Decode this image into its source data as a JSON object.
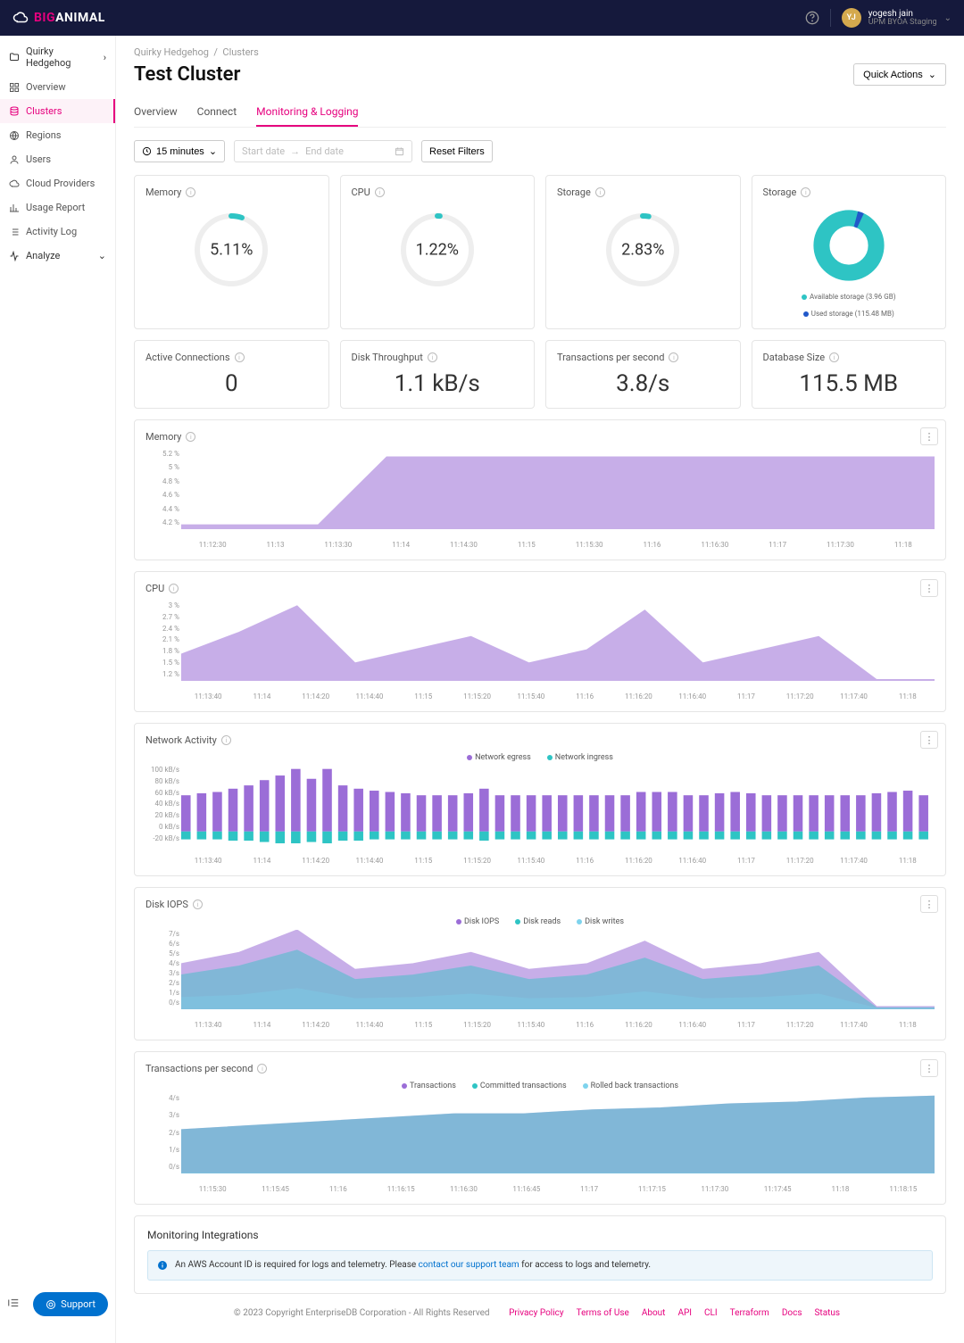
{
  "brand": {
    "big": "BIG",
    "animal": "ANIMAL"
  },
  "user": {
    "initials": "YJ",
    "name": "yogesh jain",
    "org": "UPM BYOA Staging"
  },
  "sidebar": {
    "project": "Quirky Hedgehog",
    "items": [
      {
        "label": "Overview"
      },
      {
        "label": "Clusters"
      },
      {
        "label": "Regions"
      },
      {
        "label": "Users"
      },
      {
        "label": "Cloud Providers"
      },
      {
        "label": "Usage Report"
      },
      {
        "label": "Activity Log"
      },
      {
        "label": "Analyze"
      }
    ],
    "support": "Support"
  },
  "breadcrumb": {
    "project": "Quirky Hedgehog",
    "section": "Clusters"
  },
  "page": {
    "title": "Test Cluster",
    "quick_actions": "Quick Actions"
  },
  "tabs": [
    "Overview",
    "Connect",
    "Monitoring & Logging"
  ],
  "filters": {
    "timerange": "15 minutes",
    "start": "Start date",
    "end": "End date",
    "reset": "Reset Filters"
  },
  "gauges": [
    {
      "title": "Memory",
      "value": "5.11%",
      "pct": 5.11
    },
    {
      "title": "CPU",
      "value": "1.22%",
      "pct": 1.22
    },
    {
      "title": "Storage",
      "value": "2.83%",
      "pct": 2.83
    }
  ],
  "storage_donut": {
    "title": "Storage",
    "available": "Available storage (3.96 GB)",
    "used": "Used storage (115.48 MB)"
  },
  "metrics": [
    {
      "title": "Active Connections",
      "value": "0"
    },
    {
      "title": "Disk Throughput",
      "value": "1.1 kB/s"
    },
    {
      "title": "Transactions per second",
      "value": "3.8/s"
    },
    {
      "title": "Database Size",
      "value": "115.5 MB"
    }
  ],
  "integrations": {
    "title": "Monitoring Integrations",
    "banner_pre": "An AWS Account ID is required for logs and telemetry. Please ",
    "banner_link": "contact our support team",
    "banner_post": " for access to logs and telemetry."
  },
  "footer": {
    "copy": "© 2023 Copyright EnterpriseDB Corporation - All Rights Reserved",
    "links": [
      "Privacy Policy",
      "Terms of Use",
      "About",
      "API",
      "CLI",
      "Terraform",
      "Docs",
      "Status"
    ]
  },
  "chart_data": [
    {
      "type": "area",
      "title": "Memory",
      "color": "#9b6dd7",
      "y_ticks": [
        "5.2 %",
        "5 %",
        "4.8 %",
        "4.6 %",
        "4.4 %",
        "4.2 %"
      ],
      "x_ticks": [
        "11:12:30",
        "11:13",
        "11:13:30",
        "11:14",
        "11:14:30",
        "11:15",
        "11:15:30",
        "11:16",
        "11:16:30",
        "11:17",
        "11:17:30",
        "11:18"
      ],
      "series": [
        {
          "name": "Memory",
          "values": [
            4.25,
            4.25,
            4.25,
            5.11,
            5.11,
            5.11,
            5.11,
            5.11,
            5.11,
            5.11,
            5.11,
            5.11
          ]
        }
      ],
      "ylim": [
        4.2,
        5.2
      ]
    },
    {
      "type": "area",
      "title": "CPU",
      "color": "#9b6dd7",
      "y_ticks": [
        "3 %",
        "2.7 %",
        "2.4 %",
        "2.1 %",
        "1.8 %",
        "1.5 %",
        "1.2 %"
      ],
      "x_ticks": [
        "11:13:40",
        "11:14",
        "11:14:20",
        "11:14:40",
        "11:15",
        "11:15:20",
        "11:15:40",
        "11:16",
        "11:16:20",
        "11:16:40",
        "11:17",
        "11:17:20",
        "11:17:40",
        "11:18"
      ],
      "series": [
        {
          "name": "CPU",
          "values": [
            1.8,
            2.3,
            2.9,
            1.6,
            1.9,
            2.2,
            1.6,
            1.9,
            2.8,
            1.6,
            1.9,
            2.2,
            1.22,
            1.22
          ]
        }
      ],
      "ylim": [
        1.2,
        3.0
      ]
    },
    {
      "type": "bar",
      "title": "Network Activity",
      "legend": [
        {
          "name": "Network egress",
          "color": "#9b6dd7"
        },
        {
          "name": "Network ingress",
          "color": "#2ec4c4"
        }
      ],
      "y_ticks": [
        "100 kB/s",
        "80 kB/s",
        "60 kB/s",
        "40 kB/s",
        "20 kB/s",
        "0 kB/s",
        "-20 kB/s"
      ],
      "x_ticks": [
        "11:13:40",
        "11:14",
        "11:14:20",
        "11:14:40",
        "11:15",
        "11:15:20",
        "11:15:40",
        "11:16",
        "11:16:20",
        "11:16:40",
        "11:17",
        "11:17:20",
        "11:17:40",
        "11:18"
      ],
      "series": [
        {
          "name": "Network egress",
          "values": [
            55,
            58,
            60,
            65,
            70,
            78,
            85,
            95,
            80,
            95,
            70,
            65,
            62,
            60,
            58,
            55,
            55,
            55,
            58,
            65,
            55,
            55,
            55,
            55,
            55,
            55,
            55,
            55,
            55,
            60,
            60,
            60,
            55,
            55,
            58,
            60,
            58,
            55,
            55,
            55,
            55,
            55,
            55,
            55,
            58,
            60,
            62,
            55
          ]
        },
        {
          "name": "Network ingress",
          "values": [
            -12,
            -12,
            -12,
            -14,
            -14,
            -16,
            -18,
            -18,
            -16,
            -18,
            -14,
            -14,
            -12,
            -12,
            -12,
            -12,
            -12,
            -12,
            -12,
            -14,
            -12,
            -12,
            -12,
            -12,
            -12,
            -12,
            -12,
            -12,
            -12,
            -12,
            -12,
            -12,
            -12,
            -12,
            -12,
            -12,
            -12,
            -12,
            -12,
            -12,
            -12,
            -12,
            -12,
            -12,
            -12,
            -12,
            -12,
            -12
          ]
        }
      ],
      "ylim": [
        -20,
        100
      ]
    },
    {
      "type": "area",
      "title": "Disk IOPS",
      "legend": [
        {
          "name": "Disk IOPS",
          "color": "#9b6dd7"
        },
        {
          "name": "Disk reads",
          "color": "#2ec4c4"
        },
        {
          "name": "Disk writes",
          "color": "#7ed3ed"
        }
      ],
      "y_ticks": [
        "7/s",
        "6/s",
        "5/s",
        "4/s",
        "3/s",
        "2/s",
        "1/s",
        "0/s"
      ],
      "x_ticks": [
        "11:13:40",
        "11:14",
        "11:14:20",
        "11:14:40",
        "11:15",
        "11:15:20",
        "11:15:40",
        "11:16",
        "11:16:20",
        "11:16:40",
        "11:17",
        "11:17:20",
        "11:17:40",
        "11:18"
      ],
      "series": [
        {
          "name": "Disk IOPS",
          "values": [
            4,
            5,
            7,
            3.5,
            4,
            5,
            3.5,
            4,
            6,
            3.5,
            4,
            5,
            0.2,
            0.2
          ]
        },
        {
          "name": "Disk reads",
          "values": [
            3,
            3.8,
            5.2,
            2.6,
            3,
            3.8,
            2.6,
            3,
            4.5,
            2.6,
            3,
            3.8,
            0.1,
            0.1
          ]
        },
        {
          "name": "Disk writes",
          "values": [
            1,
            1.2,
            1.8,
            0.9,
            1,
            1.3,
            0.9,
            1,
            1.5,
            0.9,
            1,
            1.3,
            0.05,
            0.05
          ]
        }
      ],
      "ylim": [
        0,
        7
      ]
    },
    {
      "type": "area",
      "title": "Transactions per second",
      "legend": [
        {
          "name": "Transactions",
          "color": "#9b6dd7"
        },
        {
          "name": "Committed transactions",
          "color": "#2ec4c4"
        },
        {
          "name": "Rolled back transactions",
          "color": "#7ed3ed"
        }
      ],
      "y_ticks": [
        "4/s",
        "3/s",
        "2/s",
        "1/s",
        "0/s"
      ],
      "x_ticks": [
        "11:15:30",
        "11:15:45",
        "11:16",
        "11:16:15",
        "11:16:30",
        "11:16:45",
        "11:17",
        "11:17:15",
        "11:17:30",
        "11:17:45",
        "11:18",
        "11:18:15"
      ],
      "series": [
        {
          "name": "Transactions",
          "values": [
            2.2,
            2.4,
            2.6,
            2.8,
            3.0,
            3.0,
            3.2,
            3.3,
            3.5,
            3.6,
            3.8,
            3.9
          ]
        },
        {
          "name": "Committed transactions",
          "values": [
            2.2,
            2.4,
            2.6,
            2.8,
            3.0,
            3.0,
            3.2,
            3.3,
            3.5,
            3.6,
            3.8,
            3.9
          ]
        },
        {
          "name": "Rolled back transactions",
          "values": [
            0,
            0,
            0,
            0,
            0,
            0,
            0,
            0,
            0,
            0,
            0,
            0
          ]
        }
      ],
      "ylim": [
        0,
        4
      ]
    }
  ]
}
